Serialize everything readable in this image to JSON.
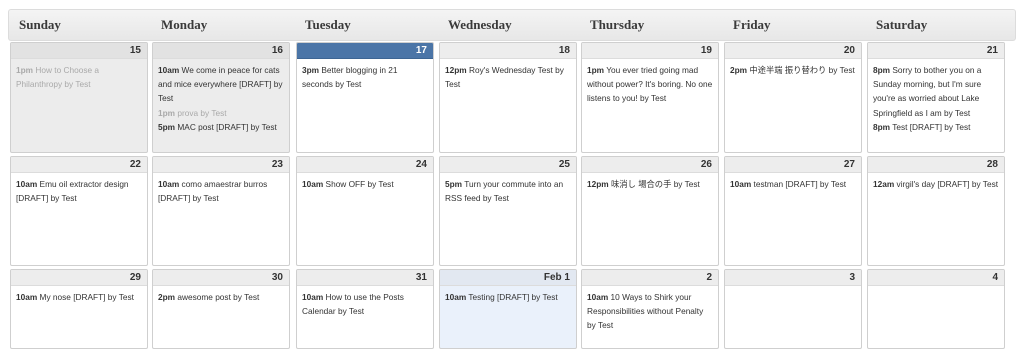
{
  "header": {
    "days": [
      "Sunday",
      "Monday",
      "Tuesday",
      "Wednesday",
      "Thursday",
      "Friday",
      "Saturday"
    ]
  },
  "weeks": [
    [
      {
        "num": "15",
        "state": "past",
        "events": [
          {
            "time": "1pm",
            "text": "How to Choose a Philanthropy by Test",
            "faded": true
          }
        ]
      },
      {
        "num": "16",
        "state": "past",
        "events": [
          {
            "time": "10am",
            "text": "We come in peace for cats and mice everywhere [DRAFT] by Test"
          },
          {
            "time": "1pm",
            "text": "prova by Test",
            "faded": true
          },
          {
            "time": "5pm",
            "text": "MAC post [DRAFT] by Test"
          }
        ]
      },
      {
        "num": "17",
        "state": "today",
        "events": [
          {
            "time": "3pm",
            "text": "Better blogging in 21 seconds by Test"
          }
        ]
      },
      {
        "num": "18",
        "state": "",
        "events": [
          {
            "time": "12pm",
            "text": "Roy's Wednesday Test by Test"
          }
        ]
      },
      {
        "num": "19",
        "state": "",
        "events": [
          {
            "time": "1pm",
            "text": "You ever tried going mad without power? It's boring. No one listens to you! by Test"
          }
        ]
      },
      {
        "num": "20",
        "state": "",
        "events": [
          {
            "time": "2pm",
            "text": "中途半端 振り替わり by Test"
          }
        ]
      },
      {
        "num": "21",
        "state": "",
        "events": [
          {
            "time": "8pm",
            "text": "Sorry to bother you on a Sunday morning, but I'm sure you're as worried about Lake Springfield as I am by Test"
          },
          {
            "time": "8pm",
            "text": "Test [DRAFT] by Test"
          }
        ]
      }
    ],
    [
      {
        "num": "22",
        "state": "",
        "events": [
          {
            "time": "10am",
            "text": "Emu oil extractor design [DRAFT] by Test"
          }
        ]
      },
      {
        "num": "23",
        "state": "",
        "events": [
          {
            "time": "10am",
            "text": "como amaestrar burros [DRAFT] by Test"
          }
        ]
      },
      {
        "num": "24",
        "state": "",
        "events": [
          {
            "time": "10am",
            "text": "Show OFF by Test"
          }
        ]
      },
      {
        "num": "25",
        "state": "",
        "events": [
          {
            "time": "5pm",
            "text": "Turn your commute into an RSS feed by Test"
          }
        ]
      },
      {
        "num": "26",
        "state": "",
        "events": [
          {
            "time": "12pm",
            "text": "味消し 場合の手 by Test"
          }
        ]
      },
      {
        "num": "27",
        "state": "",
        "events": [
          {
            "time": "10am",
            "text": "testman [DRAFT] by Test"
          }
        ]
      },
      {
        "num": "28",
        "state": "",
        "events": [
          {
            "time": "12am",
            "text": "virgil's day [DRAFT] by Test"
          }
        ]
      }
    ],
    [
      {
        "num": "29",
        "state": "",
        "events": [
          {
            "time": "10am",
            "text": "My nose [DRAFT] by Test"
          }
        ]
      },
      {
        "num": "30",
        "state": "",
        "events": [
          {
            "time": "2pm",
            "text": "awesome post by Test"
          }
        ]
      },
      {
        "num": "31",
        "state": "",
        "events": [
          {
            "time": "10am",
            "text": "How to use the Posts Calendar by Test"
          }
        ]
      },
      {
        "num": "Feb 1",
        "state": "highlight",
        "events": [
          {
            "time": "10am",
            "text": "Testing [DRAFT] by Test"
          }
        ]
      },
      {
        "num": "2",
        "state": "",
        "events": [
          {
            "time": "10am",
            "text": "10 Ways to Shirk your Responsibilities without Penalty by Test"
          }
        ]
      },
      {
        "num": "3",
        "state": "",
        "events": []
      },
      {
        "num": "4",
        "state": "",
        "events": []
      }
    ]
  ]
}
